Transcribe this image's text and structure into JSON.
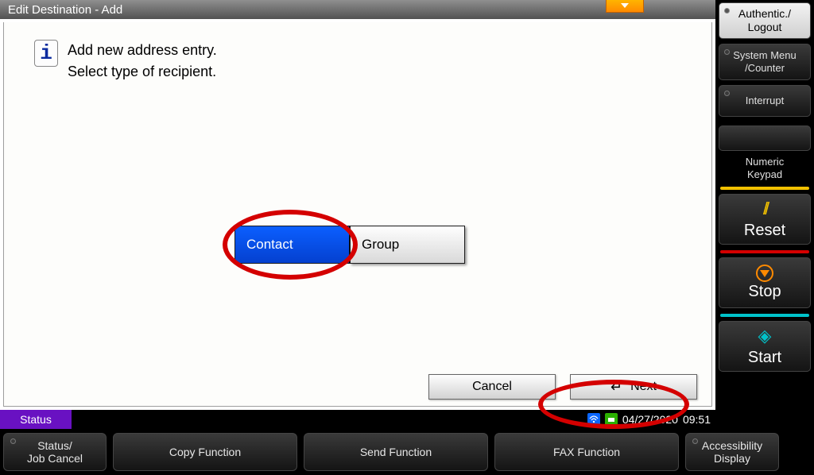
{
  "title": "Edit Destination - Add",
  "message": {
    "line1": "Add new address entry.",
    "line2": "Select type of recipient."
  },
  "options": {
    "contact": "Contact",
    "group": "Group"
  },
  "footer": {
    "cancel": "Cancel",
    "next": "Next"
  },
  "statusbar": {
    "status": "Status",
    "date": "04/27/2020",
    "time": "09:51"
  },
  "funcbar": {
    "status_job": {
      "l1": "Status/",
      "l2": "Job Cancel"
    },
    "copy": "Copy Function",
    "send": "Send Function",
    "fax": "FAX Function",
    "access": {
      "l1": "Accessibility",
      "l2": "Display"
    }
  },
  "side": {
    "auth": {
      "l1": "Authentic./",
      "l2": "Logout"
    },
    "sysmenu": {
      "l1": "System Menu",
      "l2": "/Counter"
    },
    "interrupt": "Interrupt",
    "numkeypad": {
      "l1": "Numeric",
      "l2": "Keypad"
    },
    "reset": "Reset",
    "stop": "Stop",
    "start": "Start"
  }
}
